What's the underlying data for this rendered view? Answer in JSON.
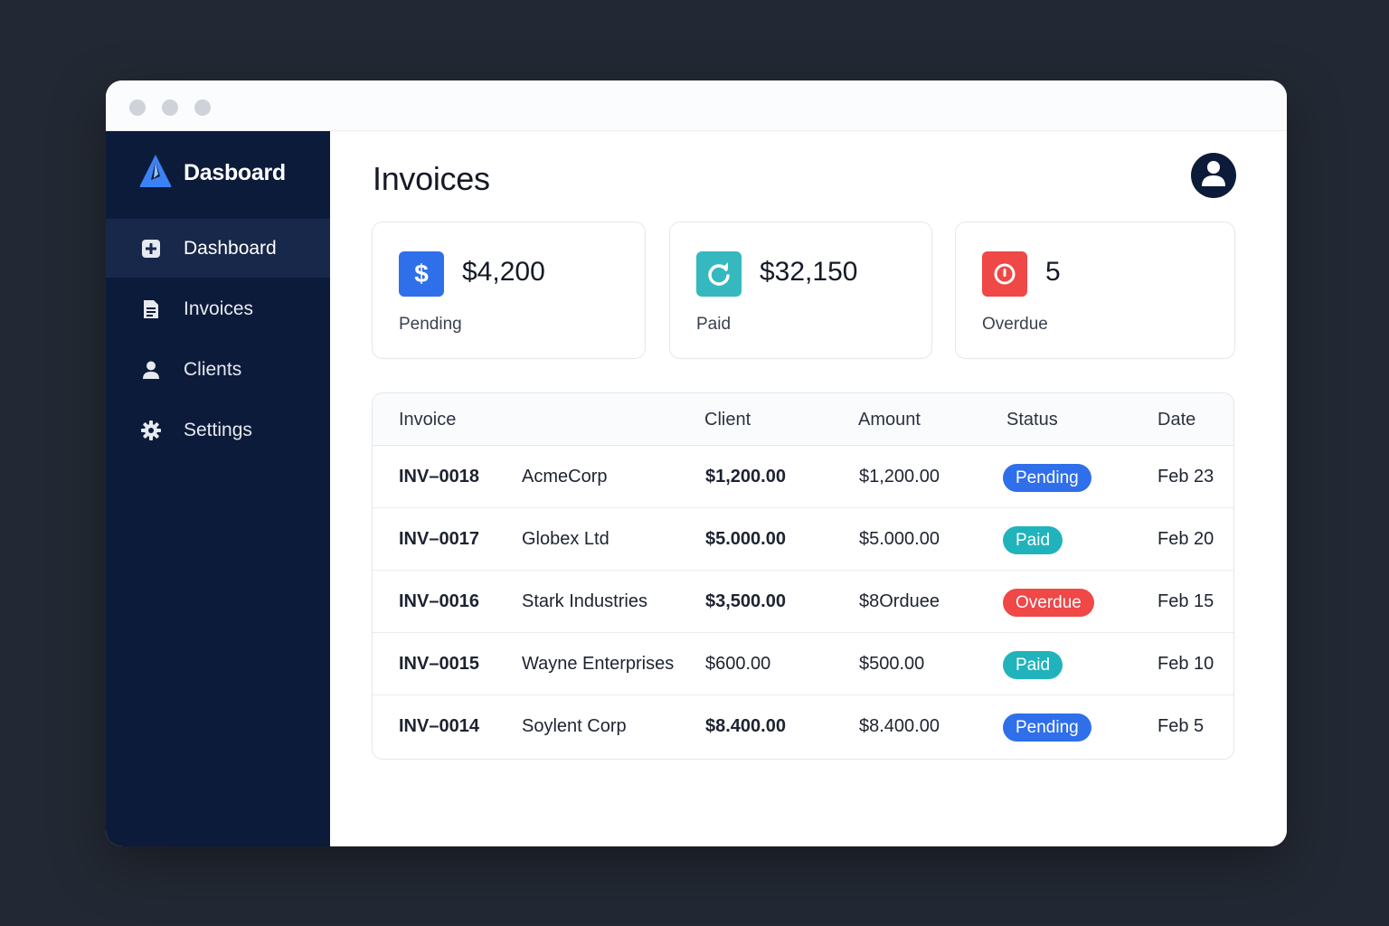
{
  "brand": {
    "name": "Dasboard"
  },
  "sidebar": {
    "items": [
      {
        "label": "Dashboard",
        "icon": "plus-square-icon",
        "active": true
      },
      {
        "label": "Invoices",
        "icon": "document-icon"
      },
      {
        "label": "Clients",
        "icon": "user-icon"
      },
      {
        "label": "Settings",
        "icon": "gear-icon"
      }
    ]
  },
  "main": {
    "title": "Invoices",
    "avatar_icon": "user-avatar-icon"
  },
  "cards": [
    {
      "value": "$4,200",
      "label": "Pending",
      "icon": "dollar-icon",
      "color": "#2f6fea"
    },
    {
      "value": "$32,150",
      "label": "Paid",
      "icon": "refresh-icon",
      "color": "#36b8bf"
    },
    {
      "value": "5",
      "label": "Overdue",
      "icon": "power-icon",
      "color": "#f04747"
    }
  ],
  "table": {
    "headers": [
      "Invoice",
      "Client",
      "Amount",
      "Status",
      "Date"
    ],
    "rows": [
      {
        "invoice": "INV–0018",
        "client": "AcmeCorp",
        "amount": "$1,200.00",
        "amount2": "$1,200.00",
        "status": "Pending",
        "date": "Feb 23"
      },
      {
        "invoice": "INV–0017",
        "client": "Globex Ltd",
        "amount": "$5.000.00",
        "amount2": "$5.000.00",
        "status": "Paid",
        "date": "Feb 20"
      },
      {
        "invoice": "INV–0016",
        "client": "Stark Industries",
        "amount": "$3,500.00",
        "amount2": "$8Orduee",
        "status": "Overdue",
        "date": "Feb 15"
      },
      {
        "invoice": "INV–0015",
        "client": "Wayne Enterprises",
        "amount": "$600.00",
        "amount2": "$500.00",
        "status": "Paid",
        "date": "Feb 10"
      },
      {
        "invoice": "INV–0014",
        "client": "Soylent Corp",
        "amount": "$8.400.00",
        "amount2": "$8.400.00",
        "status": "Pending",
        "date": "Feb 5"
      }
    ]
  },
  "colors": {
    "sidebar_bg": "#0d1b3a",
    "pending": "#2f6fea",
    "paid": "#21b3bb",
    "overdue": "#f04747"
  }
}
